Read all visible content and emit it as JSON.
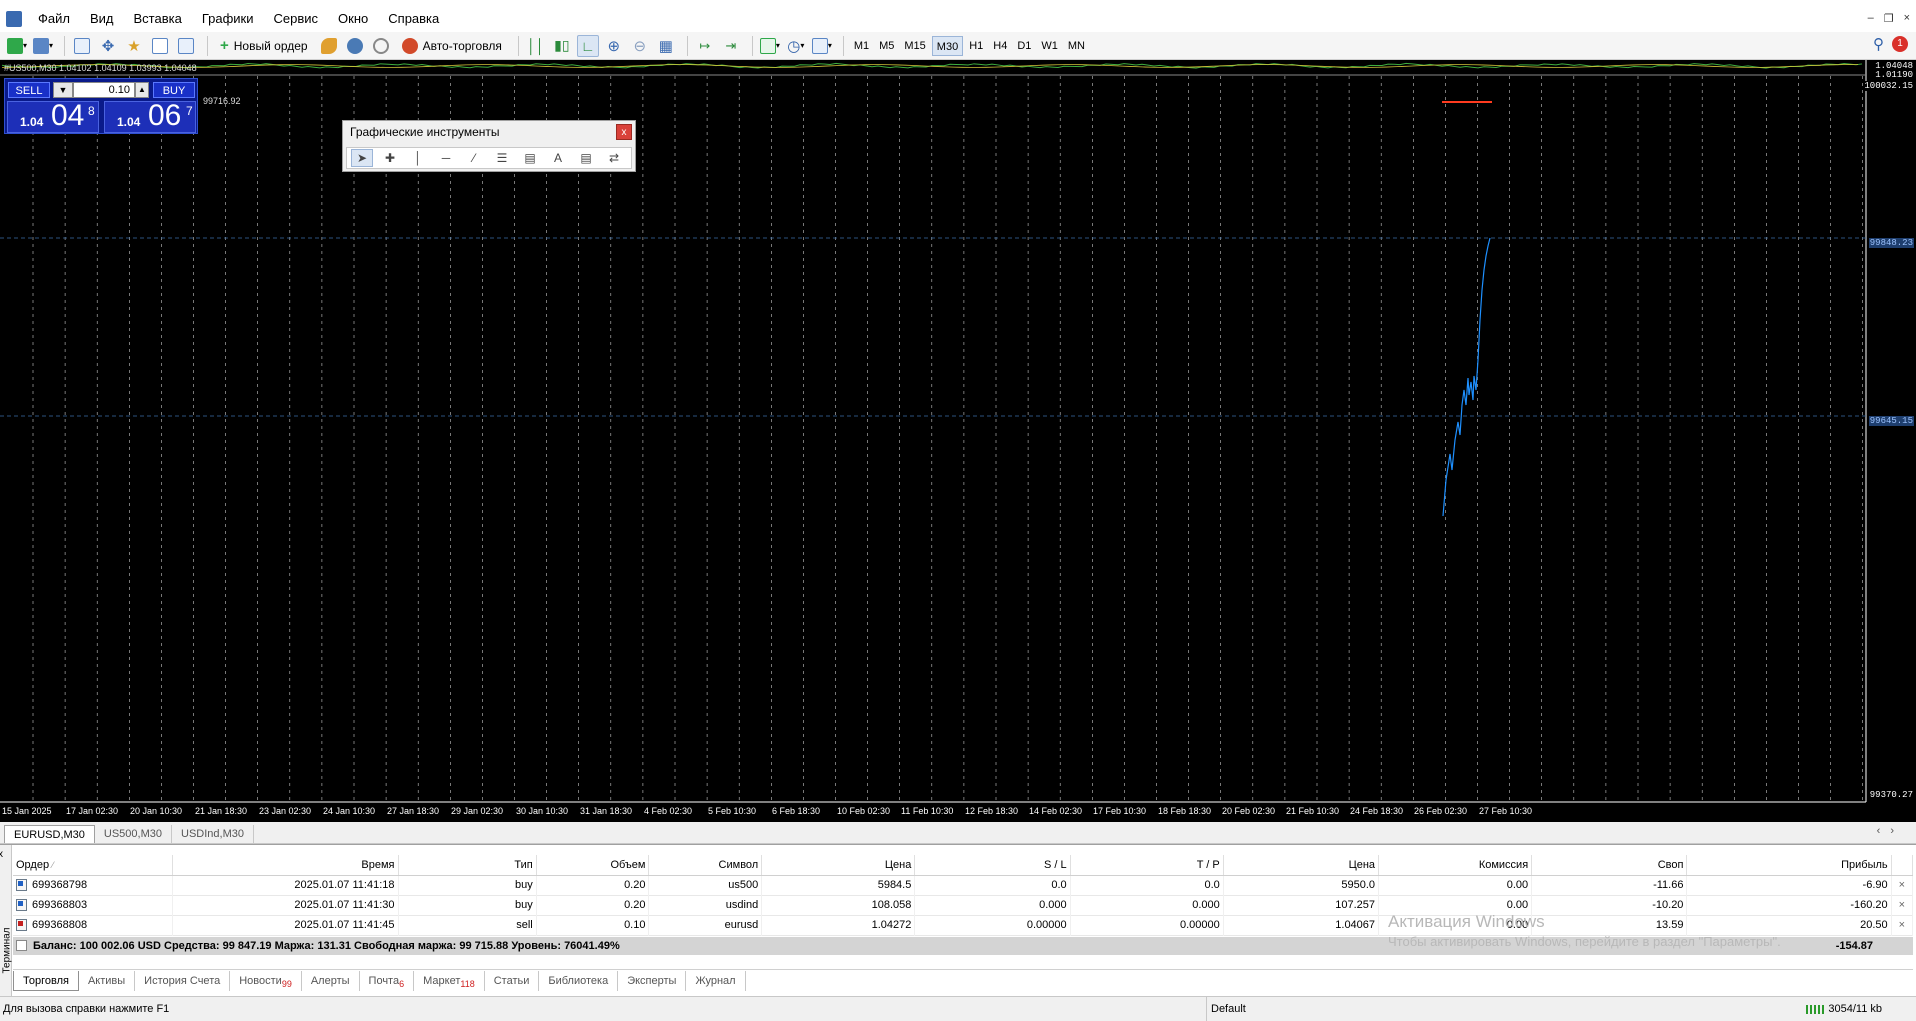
{
  "menu": {
    "items": [
      "Файл",
      "Вид",
      "Вставка",
      "Графики",
      "Сервис",
      "Окно",
      "Справка"
    ]
  },
  "toolbar": {
    "new_order": "Новый ордер",
    "autotrade": "Авто-торговля",
    "timeframes": [
      "M1",
      "M5",
      "M15",
      "M30",
      "H1",
      "H4",
      "D1",
      "W1",
      "MN"
    ],
    "active_timeframe": "M30",
    "notif_count": "1"
  },
  "chart": {
    "info": "#US500,M30 1.04102 1.04109 1.03993 1.04048",
    "info_value": "99716.92",
    "price_scale": [
      {
        "label": "1.04048",
        "pos": "top"
      },
      {
        "label": "1.01190",
        "pos": "top"
      },
      {
        "label": "100032.15",
        "pos": "top"
      },
      {
        "label": "99848.23",
        "highlight": true
      },
      {
        "label": "99645.15",
        "highlight": true
      },
      {
        "label": "99370.27",
        "pos": "bottom"
      }
    ],
    "time_labels": [
      "15 Jan 2025",
      "17 Jan 02:30",
      "20 Jan 10:30",
      "21 Jan 18:30",
      "23 Jan 02:30",
      "24 Jan 10:30",
      "27 Jan 18:30",
      "29 Jan 02:30",
      "30 Jan 10:30",
      "31 Jan 18:30",
      "4 Feb 02:30",
      "5 Feb 10:30",
      "6 Feb 18:30",
      "10 Feb 02:30",
      "11 Feb 10:30",
      "12 Feb 18:30",
      "14 Feb 02:30",
      "17 Feb 10:30",
      "18 Feb 18:30",
      "20 Feb 02:30",
      "21 Feb 10:30",
      "24 Feb 18:30",
      "26 Feb 02:30",
      "27 Feb 10:30"
    ],
    "colors": {
      "background": "#000000",
      "grid": "#c8c8c8",
      "line": "#1e90ff",
      "level": "#ff3b1f"
    }
  },
  "trade_panel": {
    "sell": "SELL",
    "buy": "BUY",
    "lot": "0.10",
    "bid": {
      "small": "1.04",
      "big": "04",
      "sup": "8"
    },
    "ask": {
      "small": "1.04",
      "big": "06",
      "sup": "7"
    }
  },
  "graphic_tools": {
    "title": "Графические инструменты",
    "close": "x"
  },
  "chart_tabs": [
    "EURUSD,M30",
    "US500,M30",
    "USDInd,M30"
  ],
  "orders": {
    "headers": [
      "Ордер",
      "Время",
      "Тип",
      "Объем",
      "Символ",
      "Цена",
      "S / L",
      "T / P",
      "Цена",
      "Комиссия",
      "Своп",
      "Прибыль"
    ],
    "rows": [
      {
        "id": "699368798",
        "time": "2025.01.07 11:41:18",
        "type": "buy",
        "volume": "0.20",
        "symbol": "us500",
        "price": "5984.5",
        "sl": "0.0",
        "tp": "0.0",
        "cur": "5950.0",
        "commission": "0.00",
        "swap": "-11.66",
        "profit": "-6.90"
      },
      {
        "id": "699368803",
        "time": "2025.01.07 11:41:30",
        "type": "buy",
        "volume": "0.20",
        "symbol": "usdind",
        "price": "108.058",
        "sl": "0.000",
        "tp": "0.000",
        "cur": "107.257",
        "commission": "0.00",
        "swap": "-10.20",
        "profit": "-160.20"
      },
      {
        "id": "699368808",
        "time": "2025.01.07 11:41:45",
        "type": "sell",
        "volume": "0.10",
        "symbol": "eurusd",
        "price": "1.04272",
        "sl": "0.00000",
        "tp": "0.00000",
        "cur": "1.04067",
        "commission": "0.00",
        "swap": "13.59",
        "profit": "20.50"
      }
    ],
    "balance_line": "Баланс: 100 002.06 USD  Средства: 99 847.19  Маржа: 131.31  Свободная маржа: 99 715.88  Уровень: 76041.49%",
    "total": "-154.87"
  },
  "terminal": {
    "label": "Терминал",
    "close": "x",
    "tabs": [
      {
        "label": "Торговля",
        "active": true
      },
      {
        "label": "Активы"
      },
      {
        "label": "История Счета"
      },
      {
        "label": "Новости",
        "badge": "99"
      },
      {
        "label": "Алерты"
      },
      {
        "label": "Почта",
        "badge": "6"
      },
      {
        "label": "Маркет",
        "badge": "118"
      },
      {
        "label": "Статьи"
      },
      {
        "label": "Библиотека"
      },
      {
        "label": "Эксперты"
      },
      {
        "label": "Журнал"
      }
    ]
  },
  "watermark": {
    "line1": "Активация Windows",
    "line2": "Чтобы активировать Windows, перейдите в раздел \"Параметры\"."
  },
  "status": {
    "help": "Для вызова справки нажмите F1",
    "profile": "Default",
    "traffic": "3054/11 kb"
  }
}
